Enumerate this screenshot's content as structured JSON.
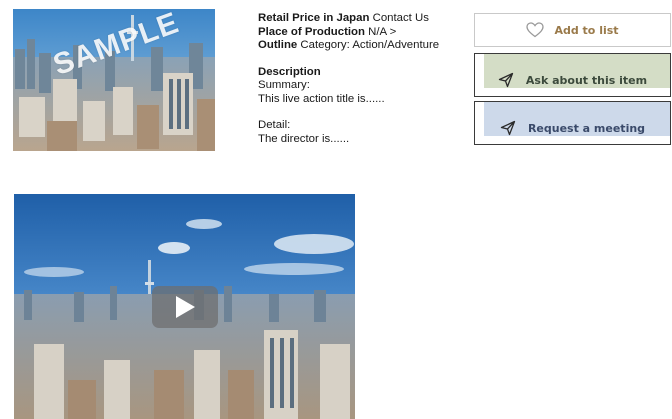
{
  "thumbnail": {
    "watermark": "SAMPLE"
  },
  "info": {
    "retail_price_label": "Retail Price in Japan",
    "retail_price_value": "Contact Us",
    "place_label": "Place of Production",
    "place_value": "N/A >",
    "outline_label": "Outline",
    "outline_value": "Category: Action/Adventure",
    "description_label": "Description",
    "summary_label": "Summary:",
    "summary_text": "This live action title is......",
    "detail_label": "Detail:",
    "detail_text": "The director is......"
  },
  "actions": {
    "add_to_list": "Add to list",
    "ask_about_item": "Ask about this item",
    "request_meeting": "Request a meeting"
  },
  "colors": {
    "add_to_list_text": "#9a7a4a",
    "ask_fill": "#d4ddc6",
    "meeting_fill": "#cdd9ea"
  },
  "icons": {
    "add_to_list": "heart-icon",
    "ask_about_item": "send-icon",
    "request_meeting": "send-icon",
    "video": "play-icon"
  }
}
